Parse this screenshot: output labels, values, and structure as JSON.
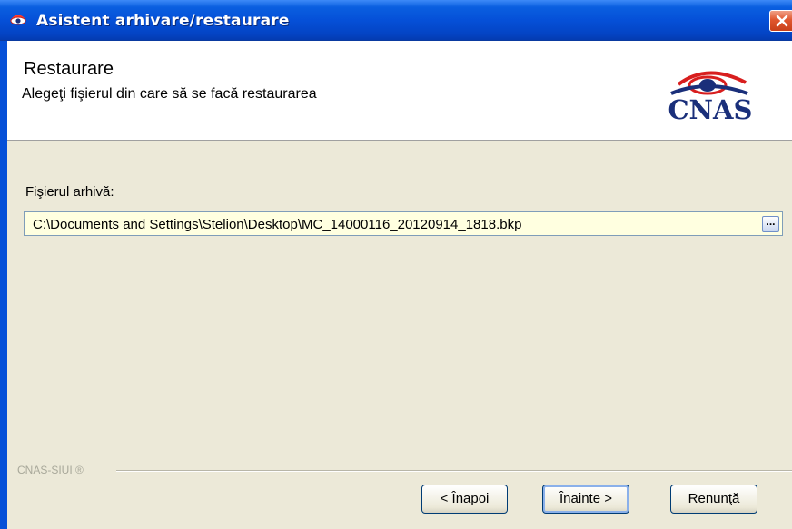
{
  "window": {
    "title": "Asistent arhivare/restaurare",
    "close_icon": "close-icon"
  },
  "header": {
    "title": "Restaurare",
    "subtitle": "Alegeţi fişierul din care să se facă restaurarea",
    "logo_text": "CNAS"
  },
  "form": {
    "archive_label": "Fişierul arhivă:",
    "archive_path": "C:\\Documents and Settings\\Stelion\\Desktop\\MC_14000116_20120914_1818.bkp",
    "browse_label": "..."
  },
  "footer": {
    "brand": "CNAS-SIUI ®",
    "back_label": "< Înapoi",
    "next_label": "Înainte >",
    "cancel_label": "Renunţă"
  },
  "colors": {
    "titlebar": "#0550d8",
    "dialog_bg": "#ece9d8",
    "input_bg": "#ffffe0",
    "logo_blue": "#1a2f7a",
    "logo_red": "#d81e1e"
  }
}
